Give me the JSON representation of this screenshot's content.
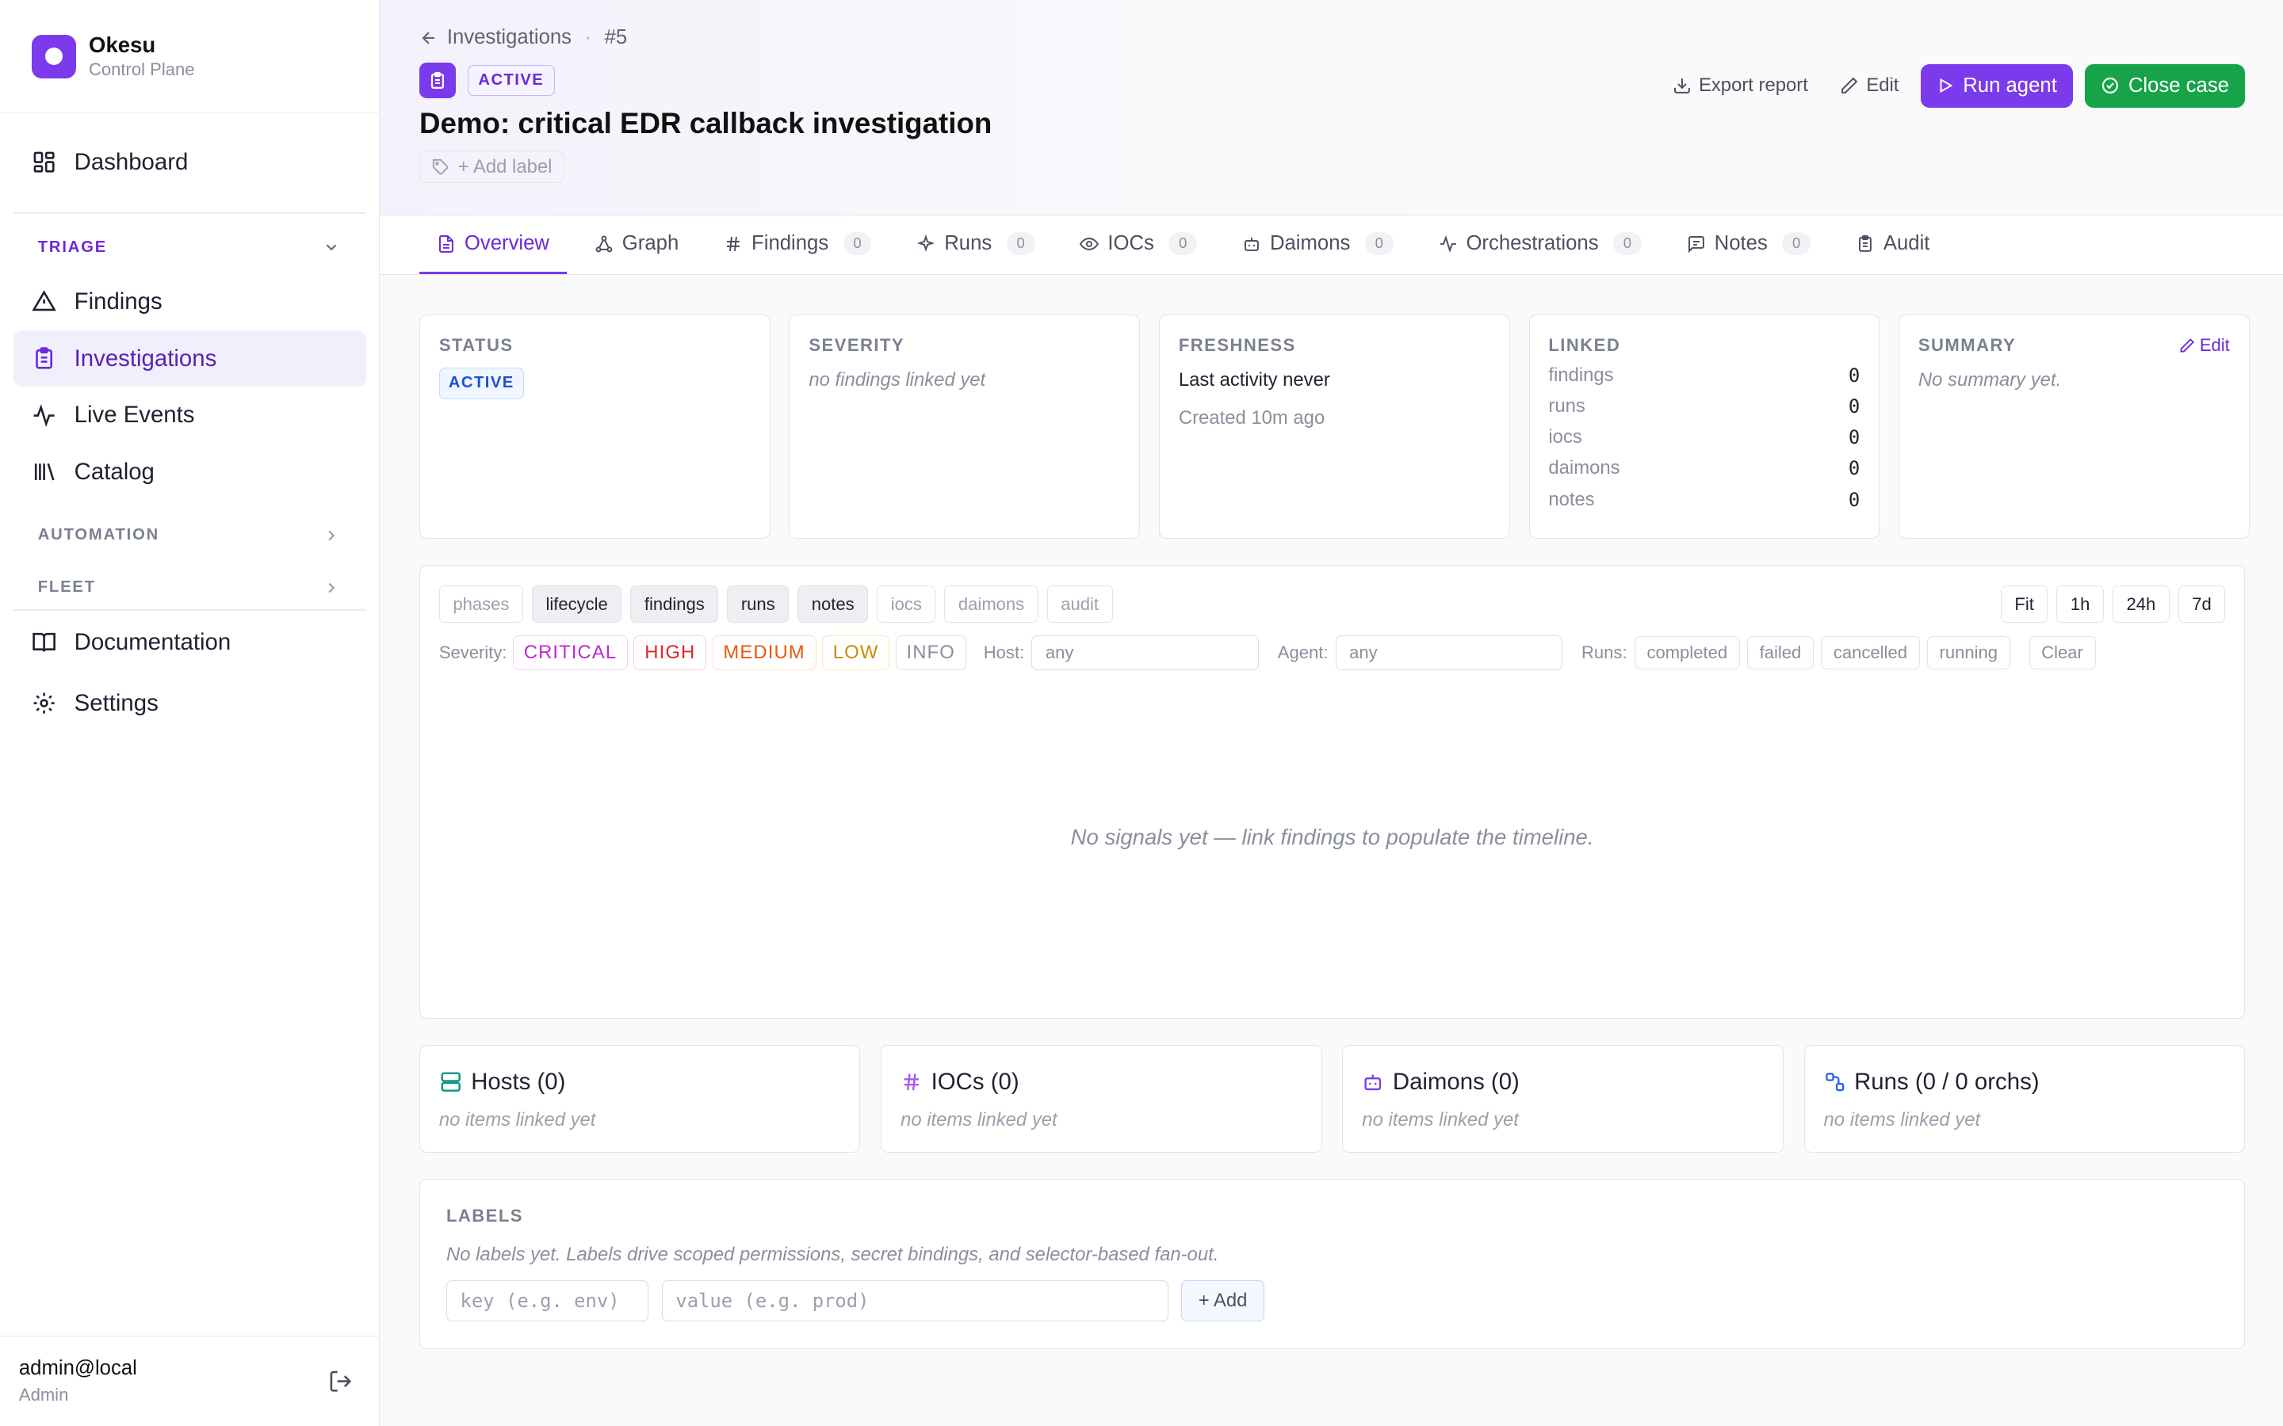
{
  "app": {
    "name": "Okesu",
    "subtitle": "Control Plane"
  },
  "sidebar": {
    "dashboard": "Dashboard",
    "triage": {
      "label": "TRIAGE",
      "items": [
        "Findings",
        "Investigations",
        "Live Events",
        "Catalog"
      ]
    },
    "automation": "AUTOMATION",
    "fleet": "FLEET",
    "documentation": "Documentation",
    "settings": "Settings"
  },
  "user": {
    "name": "admin@local",
    "role": "Admin"
  },
  "breadcrumb": {
    "parent": "Investigations",
    "sep": "·",
    "id": "#5"
  },
  "case": {
    "status_badge": "ACTIVE",
    "title": "Demo: critical EDR callback investigation",
    "add_label": "+ Add label"
  },
  "actions": {
    "export": "Export report",
    "edit": "Edit",
    "run_agent": "Run agent",
    "close_case": "Close case"
  },
  "tabs": [
    {
      "label": "Overview"
    },
    {
      "label": "Graph"
    },
    {
      "label": "Findings",
      "count": "0"
    },
    {
      "label": "Runs",
      "count": "0"
    },
    {
      "label": "IOCs",
      "count": "0"
    },
    {
      "label": "Daimons",
      "count": "0"
    },
    {
      "label": "Orchestrations",
      "count": "0"
    },
    {
      "label": "Notes",
      "count": "0"
    },
    {
      "label": "Audit"
    }
  ],
  "cards": {
    "status": {
      "label": "STATUS",
      "value": "ACTIVE"
    },
    "severity": {
      "label": "SEVERITY",
      "value": "no findings linked yet"
    },
    "freshness": {
      "label": "FRESHNESS",
      "last": "Last activity never",
      "created": "Created 10m ago"
    },
    "linked": {
      "label": "LINKED",
      "rows": [
        {
          "k": "findings",
          "v": "0"
        },
        {
          "k": "runs",
          "v": "0"
        },
        {
          "k": "iocs",
          "v": "0"
        },
        {
          "k": "daimons",
          "v": "0"
        },
        {
          "k": "notes",
          "v": "0"
        }
      ]
    },
    "summary": {
      "label": "SUMMARY",
      "edit": "Edit",
      "value": "No summary yet."
    }
  },
  "timeline": {
    "lanes": [
      {
        "label": "phases",
        "on": false
      },
      {
        "label": "lifecycle",
        "on": true
      },
      {
        "label": "findings",
        "on": true
      },
      {
        "label": "runs",
        "on": true
      },
      {
        "label": "notes",
        "on": true
      },
      {
        "label": "iocs",
        "on": false
      },
      {
        "label": "daimons",
        "on": false
      },
      {
        "label": "audit",
        "on": false
      }
    ],
    "zoom": [
      "Fit",
      "1h",
      "24h",
      "7d"
    ],
    "severity_label": "Severity:",
    "severities": [
      {
        "label": "CRITICAL",
        "color": "#c026d3",
        "border": "#f0d5f6"
      },
      {
        "label": "HIGH",
        "color": "#dc2626",
        "border": "#fbd0d0"
      },
      {
        "label": "MEDIUM",
        "color": "#ea580c",
        "border": "#fde0c8"
      },
      {
        "label": "LOW",
        "color": "#ca8a04",
        "border": "#fbeab0"
      },
      {
        "label": "INFO",
        "color": "#8a8f9c",
        "border": "#e3e3e8"
      }
    ],
    "host_label": "Host:",
    "host_placeholder": "any",
    "agent_label": "Agent:",
    "agent_placeholder": "any",
    "runs_label": "Runs:",
    "run_states": [
      "completed",
      "failed",
      "cancelled",
      "running"
    ],
    "clear": "Clear",
    "empty": "No signals yet — link findings to populate the timeline."
  },
  "mini_cards": [
    {
      "title": "Hosts (0)",
      "body": "no items linked yet",
      "icon": "server-icon",
      "color": "#0d9488"
    },
    {
      "title": "IOCs (0)",
      "body": "no items linked yet",
      "icon": "hash-icon",
      "color": "#a855f7"
    },
    {
      "title": "Daimons (0)",
      "body": "no items linked yet",
      "icon": "bot-icon",
      "color": "#7c3aed"
    },
    {
      "title": "Runs (0 / 0 orchs)",
      "body": "no items linked yet",
      "icon": "workflow-icon",
      "color": "#2563eb"
    }
  ],
  "labels": {
    "heading": "LABELS",
    "hint": "No labels yet. Labels drive scoped permissions, secret bindings, and selector-based fan-out.",
    "key_placeholder": "key (e.g. env)",
    "value_placeholder": "value (e.g. prod)",
    "add": "+ Add"
  },
  "colors": {
    "accent": "#7c3aed",
    "success": "#16a34a"
  }
}
